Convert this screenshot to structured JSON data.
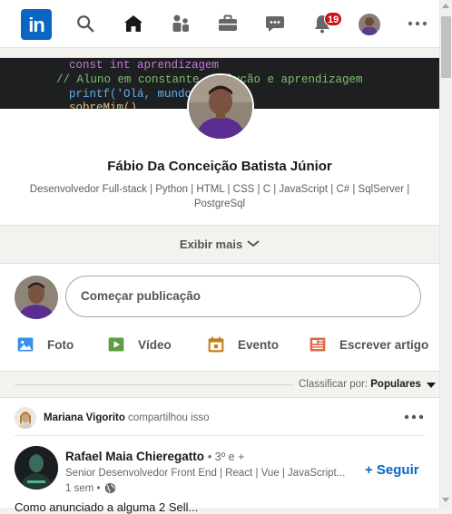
{
  "nav": {
    "logo_text": "in",
    "icons": [
      "search-icon",
      "home-icon",
      "network-icon",
      "jobs-icon",
      "messaging-icon",
      "notifications-icon",
      "avatar",
      "more-icon"
    ],
    "notification_count": "19",
    "accent": "#0a66c2",
    "badge_color": "#cc1016"
  },
  "profile": {
    "banner_code": [
      "const int aprendizagem",
      "// Aluno em constante evolução e aprendizagem",
      "printf('Olá, mundo",
      "sobreMim()"
    ],
    "name": "Fábio Da Conceição Batista Júnior",
    "headline": "Desenvolvedor Full-stack | Python | HTML | CSS | C | JavaScript | C# | SqlServer | PostgreSql",
    "show_more": "Exibir mais"
  },
  "share": {
    "placeholder": "Começar publicação",
    "actions": [
      {
        "label": "Foto",
        "icon": "photo-icon",
        "color": "#378fe9"
      },
      {
        "label": "Vídeo",
        "icon": "video-icon",
        "color": "#5f9b41"
      },
      {
        "label": "Evento",
        "icon": "event-icon",
        "color": "#c37d16"
      },
      {
        "label": "Escrever artigo",
        "icon": "article-icon",
        "color": "#e06847"
      }
    ]
  },
  "sort": {
    "label": "Classificar por:",
    "value": "Populares"
  },
  "post": {
    "sharer_name": "Mariana Vigorito",
    "sharer_action": "compartilhou isso",
    "author_name": "Rafael Maia Chieregatto",
    "author_degree": "• 3º e +",
    "author_headline": "Senior Desenvolvedor Front End | React | Vue | JavaScript...",
    "time": "1 sem •",
    "follow_label": "+ Seguir",
    "text_start": "Como anunciado a alguma   2 Sell..."
  }
}
